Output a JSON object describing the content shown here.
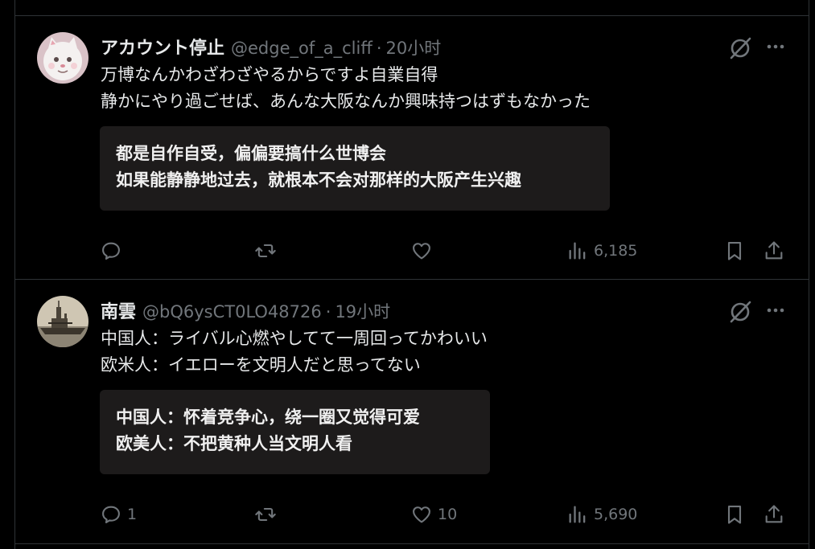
{
  "tweets": [
    {
      "name": "アカウント停止",
      "handle": "@edge_of_a_cliff",
      "dot": "·",
      "time": "20小时",
      "body": [
        "万博なんかわざわざやるからですよ自業自得",
        "静かにやり過ごせば、あんな大阪なんか興味持つはずもなかった"
      ],
      "translation": [
        "都是自作自受，偏偏要搞什么世博会",
        "如果能静静地过去，就根本不会对那样的大阪产生兴趣"
      ],
      "replies": "",
      "retweets": "",
      "likes": "",
      "views": "6,185",
      "avatar": "white-cat-avatar"
    },
    {
      "name": "南雲",
      "handle": "@bQ6ysCT0LO48726",
      "dot": "·",
      "time": "19小时",
      "body": [
        "中国人：ライバル心燃やしてて一周回ってかわいい",
        "欧米人：イエローを文明人だと思ってない"
      ],
      "translation": [
        "中国人：怀着竞争心，绕一圈又觉得可爱",
        "欧美人：不把黄种人当文明人看"
      ],
      "replies": "1",
      "retweets": "",
      "likes": "10",
      "views": "5,690",
      "avatar": "battleship-avatar"
    }
  ],
  "colors": {
    "background": "#000000",
    "text": "#e7e9ea",
    "muted": "#71767b",
    "border": "#2f3336",
    "translation_bg": "#1d1b1b"
  }
}
